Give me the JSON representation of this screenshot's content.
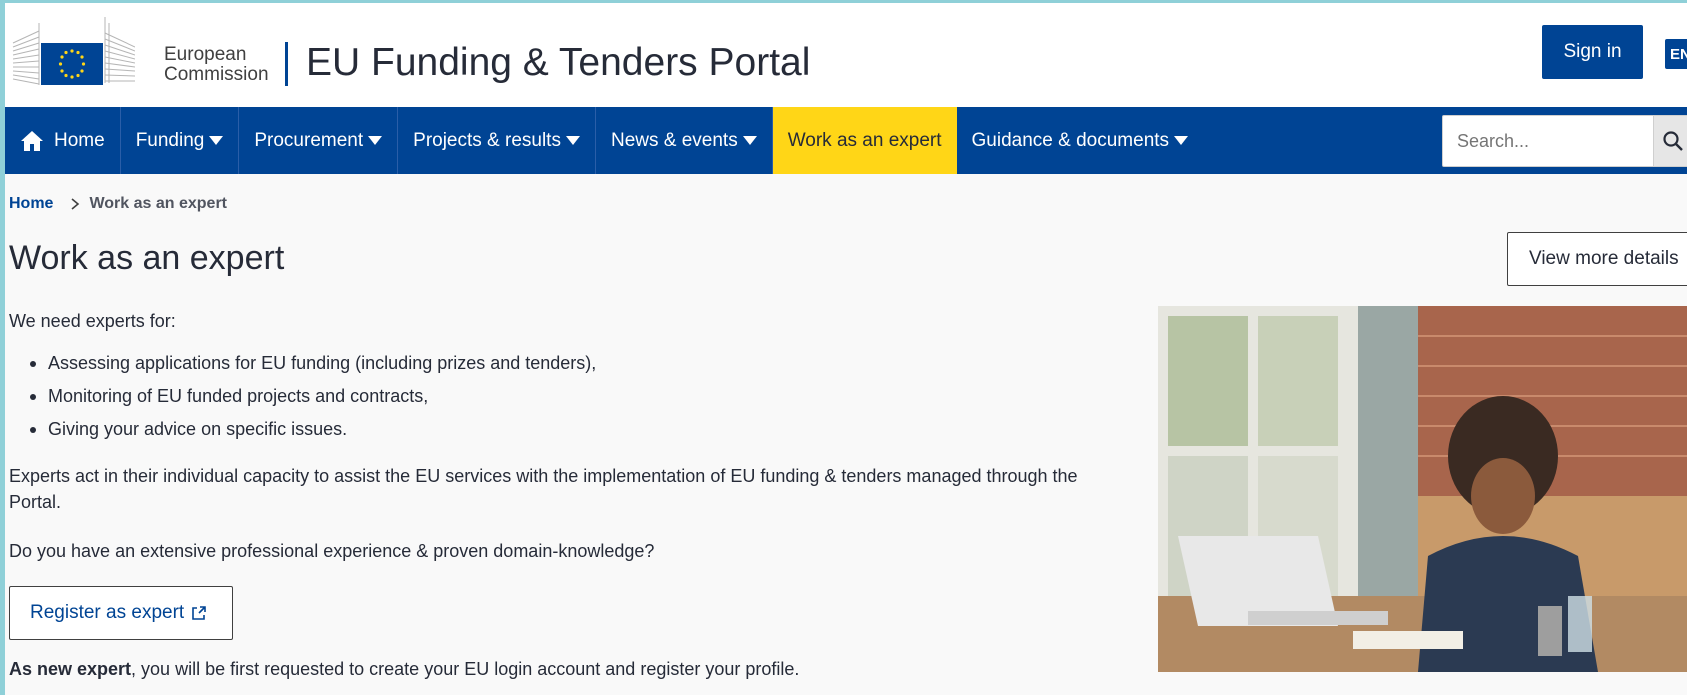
{
  "header": {
    "org_line1": "European",
    "org_line2": "Commission",
    "site_title": "EU Funding & Tenders Portal",
    "signin_label": "Sign in",
    "lang_code": "EN"
  },
  "nav": {
    "items": [
      {
        "label": "Home",
        "icon": "home-icon",
        "dropdown": false
      },
      {
        "label": "Funding",
        "dropdown": true
      },
      {
        "label": "Procurement",
        "dropdown": true
      },
      {
        "label": "Projects & results",
        "dropdown": true
      },
      {
        "label": "News & events",
        "dropdown": true
      },
      {
        "label": "Work as an expert",
        "dropdown": false,
        "active": true
      },
      {
        "label": "Guidance & documents",
        "dropdown": true
      }
    ],
    "search_placeholder": "Search...",
    "search_icon": "search-icon"
  },
  "breadcrumb": {
    "home": "Home",
    "current": "Work as an expert"
  },
  "main": {
    "title": "Work as an expert",
    "view_more_label": "View more details",
    "intro": "We need experts for:",
    "bullets": [
      "Assessing applications for EU funding (including prizes and tenders),",
      "Monitoring of EU funded projects and contracts,",
      "Giving your advice on specific issues."
    ],
    "paragraph1": "Experts act in their individual capacity to assist the EU services with the implementation of EU funding & tenders managed through the Portal.",
    "paragraph2": "Do you have an extensive professional experience & proven domain-knowledge?",
    "register_label": "Register as expert",
    "note_bold": "As new expert",
    "note_rest": ", you will be first requested to create your EU login account and register your profile."
  },
  "colors": {
    "brand_blue": "#004494",
    "active_yellow": "#ffd617",
    "text": "#262b38"
  }
}
